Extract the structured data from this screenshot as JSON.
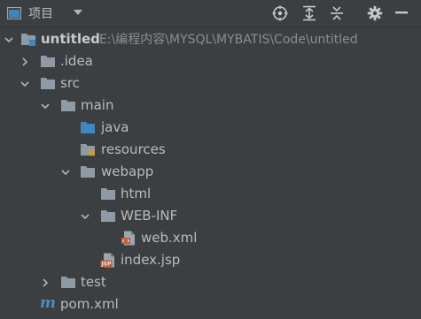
{
  "toolbar": {
    "title": "项目",
    "icons": [
      "panel-icon",
      "chevron-down-icon",
      "locate-icon",
      "expand-all-icon",
      "collapse-all-icon",
      "gear-icon",
      "hide-icon"
    ]
  },
  "tree": {
    "root": {
      "label": "untitled",
      "path": "E:\\编程内容\\MYSQL\\MYBATIS\\Code\\untitled"
    },
    "idea": ".idea",
    "src": "src",
    "main": "main",
    "java": "java",
    "resources": "resources",
    "webapp": "webapp",
    "html": "html",
    "webinf": "WEB-INF",
    "webxml": "web.xml",
    "indexjsp": "index.jsp",
    "test": "test",
    "pom": "pom.xml"
  },
  "colors": {
    "background": "#3c3f41",
    "folder": "#8e9aa5",
    "source_folder": "#3e86c1",
    "resource_mark": "#d89a2a",
    "file_accent": "#c75a3a",
    "maven": "#4a8ec2"
  }
}
